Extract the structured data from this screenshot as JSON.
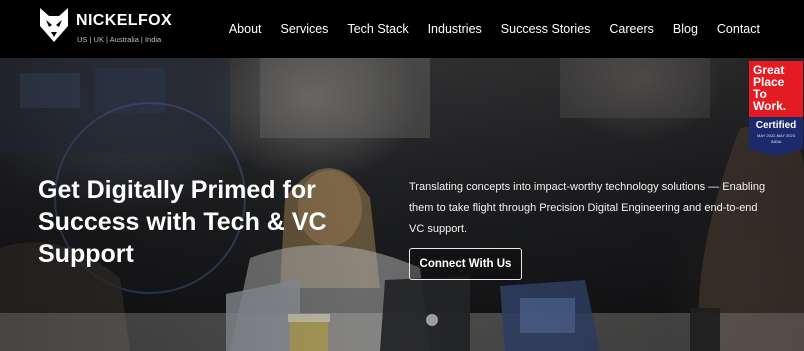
{
  "brand": {
    "name": "NICKELFOX",
    "tagline": "US | UK | Australia | India"
  },
  "nav": {
    "items": [
      "About",
      "Services",
      "Tech Stack",
      "Industries",
      "Success Stories",
      "Careers",
      "Blog",
      "Contact"
    ]
  },
  "hero": {
    "headline": "Get Digitally Primed for Success with Tech & VC Support",
    "description": "Translating concepts into impact-worthy technology solutions — Enabling them to take flight through Precision Digital Engineering and end-to-end VC support.",
    "cta_label": "Connect With Us"
  },
  "badge": {
    "lines": [
      "Great",
      "Place",
      "To",
      "Work."
    ],
    "certified": "Certified",
    "dates": "MAY 2022-MAY 2023",
    "country": "INDIA"
  }
}
